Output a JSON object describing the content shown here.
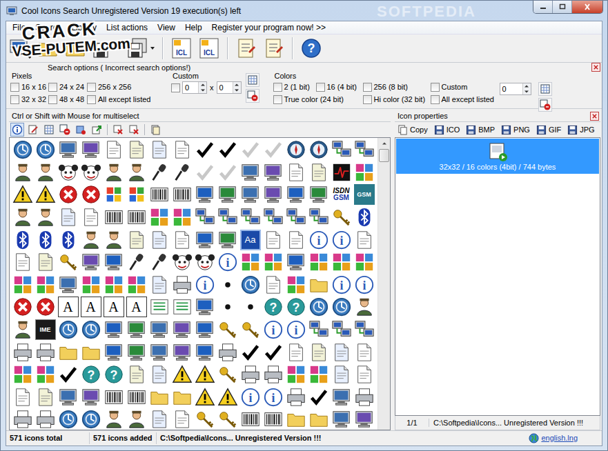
{
  "window": {
    "title": "Cool Icons Search  Unregistered Version 19 execution(s) left",
    "watermark": "SOFTPEDIA"
  },
  "overlay_watermark": {
    "lines": [
      "CRACK",
      "VSE-PUTEM.com"
    ]
  },
  "glyphs": {
    "help": "?",
    "info": "i"
  },
  "menu": [
    "File",
    "Search",
    "Library",
    "List actions",
    "View",
    "Help",
    "Register your program now! >>"
  ],
  "toolbar": [
    {
      "kind": "computer",
      "dropdown": false,
      "text": ""
    },
    {
      "kind": "folder",
      "dropdown": false,
      "text": ""
    },
    {
      "kind": "folder",
      "dropdown": false,
      "text": ""
    },
    {
      "kind": "save",
      "dropdown": true,
      "text": ""
    },
    {
      "kind": "save-multi",
      "dropdown": true,
      "text": ""
    },
    {
      "kind": "separator",
      "dropdown": false,
      "text": ""
    },
    {
      "kind": "icl",
      "dropdown": false,
      "text": "ICL"
    },
    {
      "kind": "icl",
      "dropdown": false,
      "text": "ICL"
    },
    {
      "kind": "separator",
      "dropdown": false,
      "text": ""
    },
    {
      "kind": "note",
      "dropdown": false,
      "text": ""
    },
    {
      "kind": "note",
      "dropdown": false,
      "text": ""
    },
    {
      "kind": "separator",
      "dropdown": false,
      "text": ""
    },
    {
      "kind": "help",
      "dropdown": false,
      "text": ""
    }
  ],
  "search_options": {
    "title": "Search options ( Incorrect search options!)",
    "pixels": {
      "label": "Pixels",
      "options": [
        {
          "label": "16 x 16",
          "checked": false
        },
        {
          "label": "24 x 24",
          "checked": false
        },
        {
          "label": "256 x 256",
          "checked": false
        },
        {
          "label": "32 x 32",
          "checked": false
        },
        {
          "label": "48 x 48",
          "checked": false
        },
        {
          "label": "All except listed",
          "checked": false
        }
      ]
    },
    "custom": {
      "label": "Custom",
      "checked": false,
      "width": "0",
      "separator": "x",
      "height": "0"
    },
    "colors": {
      "label": "Colors",
      "value": "0",
      "options": [
        {
          "label": "2 (1 bit)",
          "checked": false
        },
        {
          "label": "16 (4 bit)",
          "checked": false
        },
        {
          "label": "256 (8 bit)",
          "checked": false
        },
        {
          "label": "Custom",
          "checked": false
        },
        {
          "label": "True color (24 bit)",
          "checked": false
        },
        {
          "label": "Hi color (32 bit)",
          "checked": false
        },
        {
          "label": "All except listed",
          "checked": false
        }
      ]
    }
  },
  "left_pane": {
    "title": "Ctrl or Shift with Mouse for multiselect",
    "tools": [
      {
        "kind": "info",
        "selected": true
      },
      {
        "kind": "edit",
        "selected": false
      },
      {
        "kind": "grid",
        "selected": false
      },
      {
        "kind": "grid-delete",
        "selected": false
      },
      {
        "kind": "tag",
        "selected": false
      },
      {
        "kind": "export",
        "selected": false
      },
      {
        "kind": "separator",
        "selected": false
      },
      {
        "kind": "remove",
        "selected": false
      },
      {
        "kind": "remove-all",
        "selected": false
      },
      {
        "kind": "separator",
        "selected": false
      },
      {
        "kind": "copy",
        "selected": false
      }
    ]
  },
  "icon_grid": {
    "texts": [
      "ISDN",
      "GSM",
      "GSM",
      "Aa",
      "A",
      "A",
      "A",
      "A",
      "IME"
    ]
  },
  "right_pane": {
    "title": "Icon properties",
    "actions": [
      {
        "label": "Copy",
        "kind": "copy"
      },
      {
        "label": "ICO",
        "kind": "save"
      },
      {
        "label": "BMP",
        "kind": "save"
      },
      {
        "label": "PNG",
        "kind": "save"
      },
      {
        "label": "GIF",
        "kind": "save"
      },
      {
        "label": "JPG",
        "kind": "save"
      }
    ],
    "items": [
      {
        "caption": "32x32 / 16 colors (4bit) / 744 bytes",
        "selected": true
      }
    ],
    "footer": {
      "page": "1/1",
      "path": "C:\\Softpedia\\Icons... Unregistered Version !!!"
    }
  },
  "status_bar": {
    "total": "571 icons total",
    "added": "571 icons added",
    "path": "C:\\Softpedia\\Icons... Unregistered Version !!!",
    "language": "english.lng"
  }
}
